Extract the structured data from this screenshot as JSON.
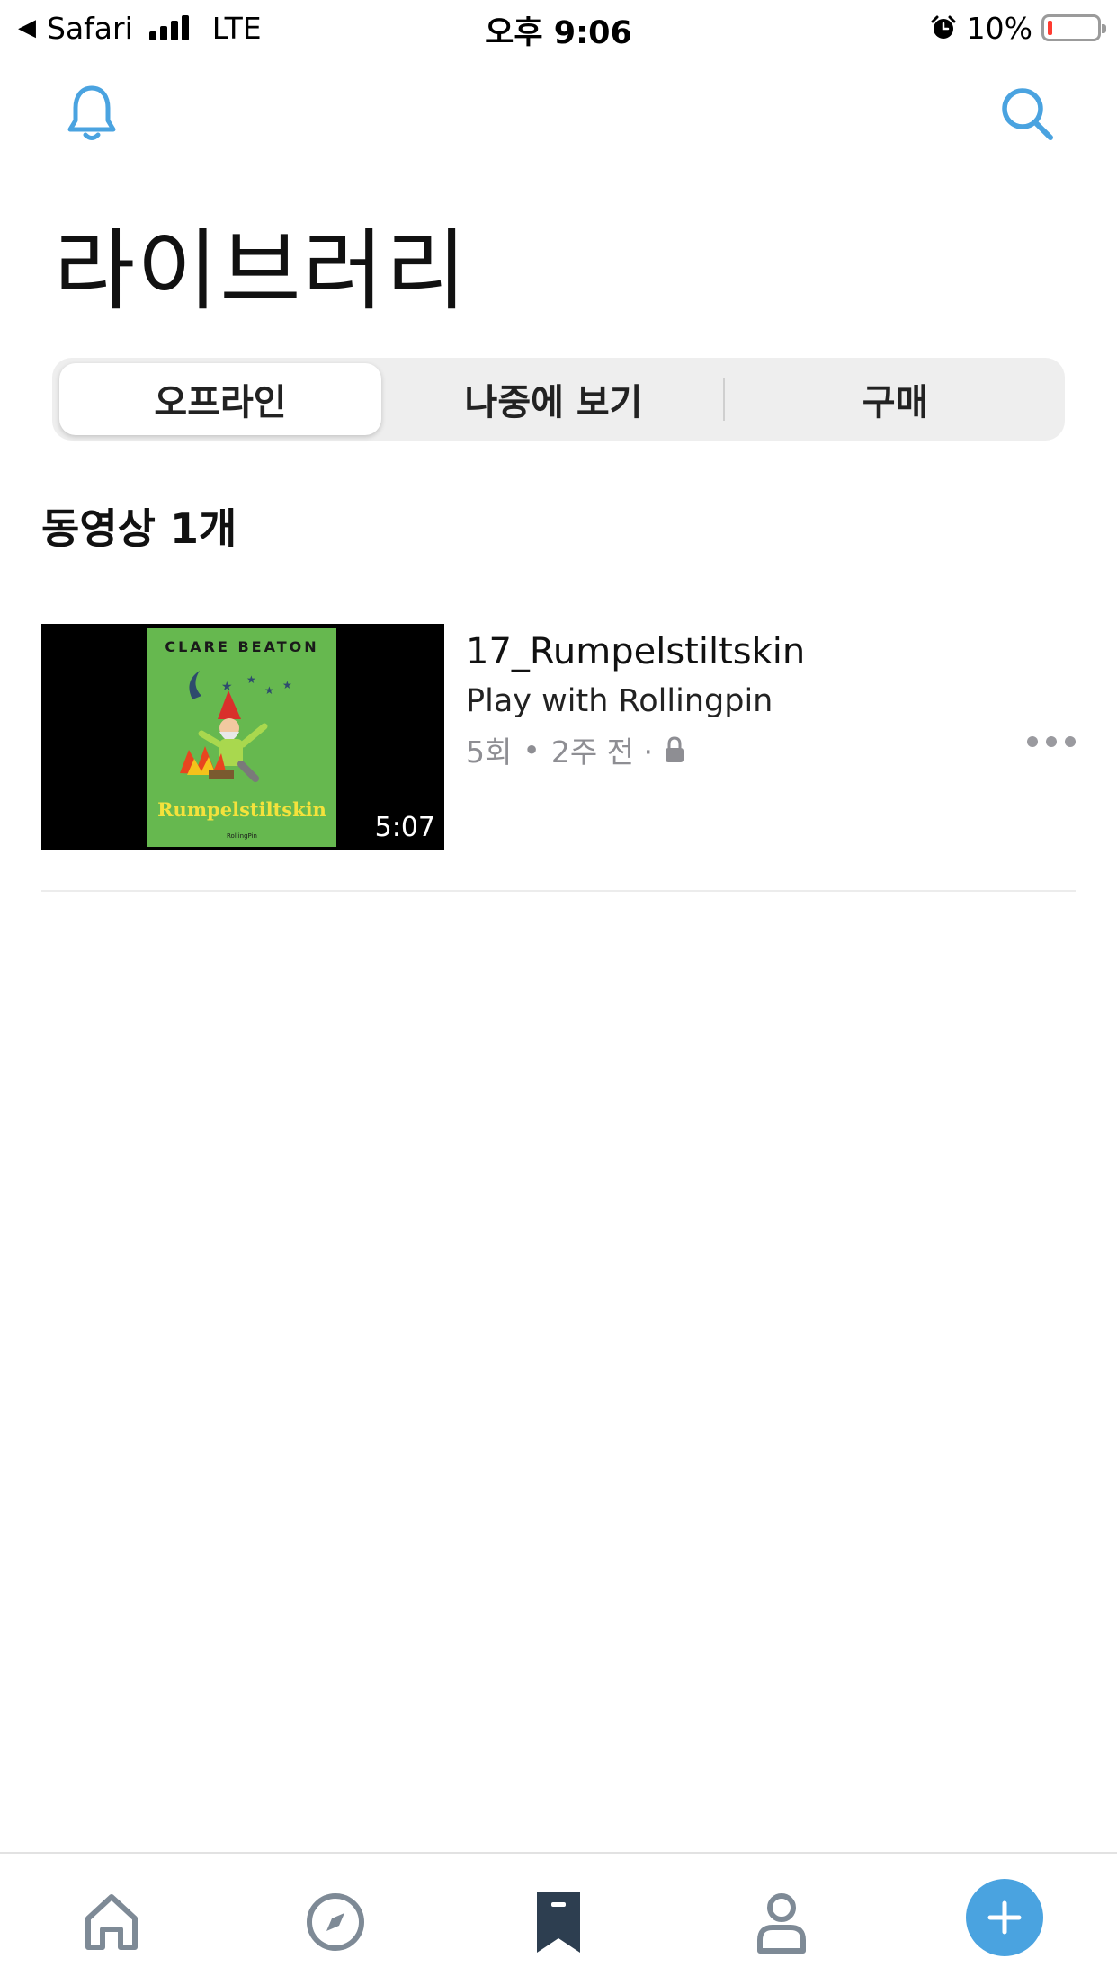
{
  "status_bar": {
    "back_app": "Safari",
    "network": "LTE",
    "time": "오후 9:06",
    "battery_percent": "10%",
    "battery_level": 0.1
  },
  "header": {
    "left_icon": "bell-icon",
    "right_icon": "search-icon",
    "title": "라이브러리"
  },
  "tabs": [
    "오프라인",
    "나중에 보기",
    "구매"
  ],
  "selected_tab": "오프라인",
  "section": {
    "title": "동영상 1개"
  },
  "videos": [
    {
      "title": "17_Rumpelstiltskin",
      "channel": "Play with Rollingpin",
      "views": "5회",
      "separator": "•",
      "age": "2주 전 ·",
      "privacy_icon": "lock-icon",
      "duration": "5:07",
      "thumbnail": {
        "author": "CLARE BEATON",
        "book_title": "Rumpelstiltskin",
        "publisher": "RollingPin"
      }
    }
  ],
  "tab_bar": {
    "items": [
      "home-icon",
      "compass-icon",
      "bookmark-icon",
      "profile-icon",
      "plus-icon"
    ],
    "active": "bookmark-icon"
  },
  "colors": {
    "accent": "#4aa3e0",
    "battery_low": "#ff3b30",
    "cover_green": "#66b84f",
    "tab_icon": "#7e8a96",
    "tab_active": "#2d3e50"
  }
}
